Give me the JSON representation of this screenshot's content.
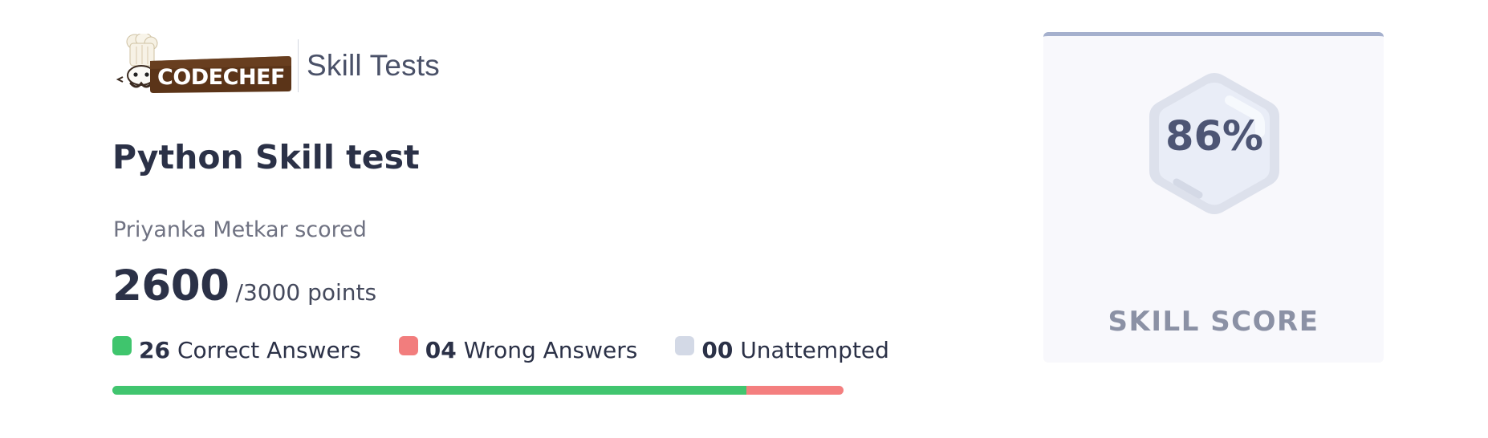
{
  "header": {
    "logo_text": "CODECHEF",
    "product_name": "Skill Tests"
  },
  "test": {
    "title": "Python Skill test",
    "scored_label": "Priyanka Metkar scored",
    "score": "2600",
    "total_label": "/3000 points"
  },
  "answers": {
    "correct": {
      "count": "26",
      "label": "Correct Answers"
    },
    "wrong": {
      "count": "04",
      "label": "Wrong Answers"
    },
    "unattempted": {
      "count": "00",
      "label": "Unattempted"
    }
  },
  "progress": {
    "correct_fraction": 0.8667,
    "wrong_fraction": 0.1333,
    "unattempted_fraction": 0
  },
  "skill_card": {
    "value": "86%",
    "label": "SKILL SCORE"
  },
  "colors": {
    "correct": "#3fc56d",
    "wrong": "#f27d7d",
    "unattempted": "#d3d9e6",
    "logo_brown": "#5b3418",
    "card_accent": "#a5b0cd"
  },
  "icons": {
    "logo": "chef-hat-logo-icon",
    "badge": "hexagon-badge-icon"
  }
}
